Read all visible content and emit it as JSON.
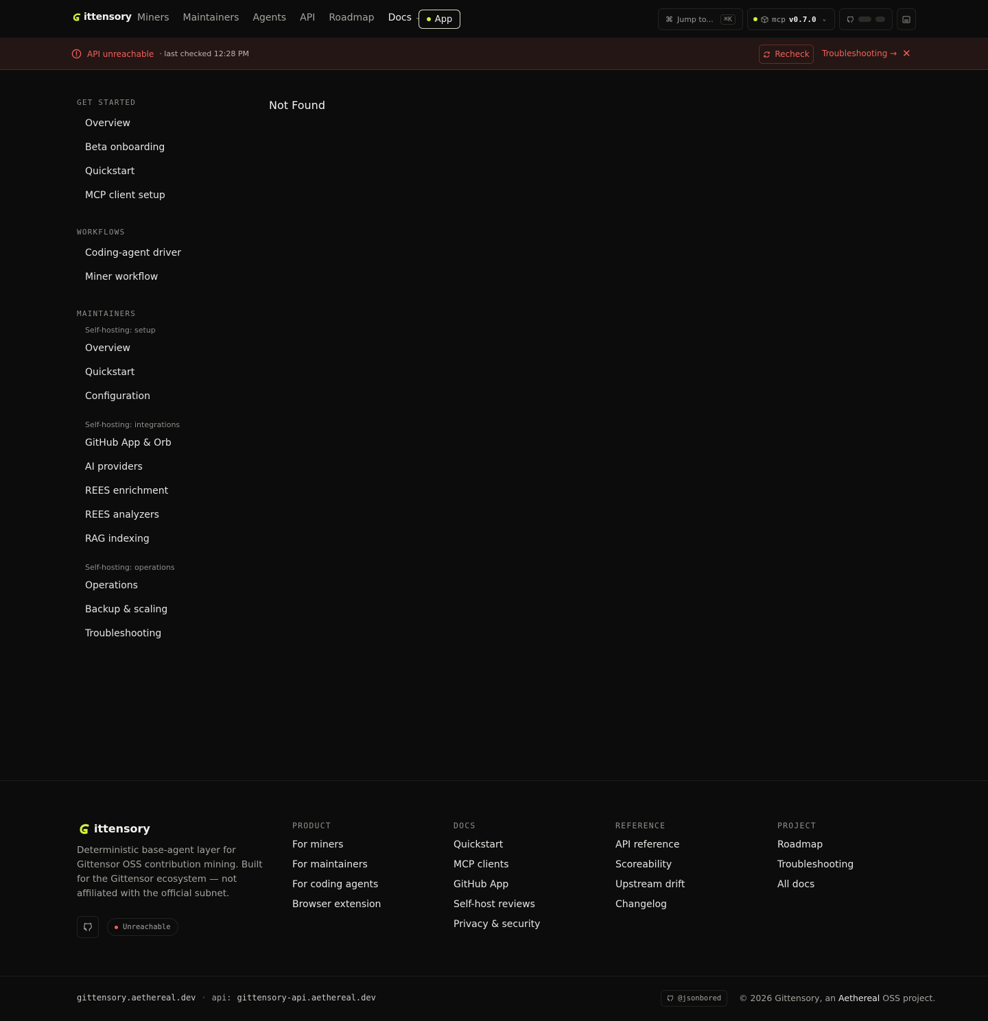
{
  "brand": {
    "name": "ittensory",
    "logo_icon": "g-leaf-logo",
    "accent": "#d4f03a"
  },
  "nav": {
    "links": [
      "Miners",
      "Maintainers",
      "Agents",
      "API",
      "Roadmap"
    ],
    "docs_label": "Docs",
    "app_label": "App",
    "jump_label": "Jump to...",
    "jump_shortcut": "⌘K",
    "mcp_label": "mcp",
    "mcp_version": "v0.7.0"
  },
  "alert": {
    "title": "API unreachable",
    "subtitle": "· last checked 12:28 PM",
    "recheck_label": "Recheck",
    "troubleshooting_label": "Troubleshooting →",
    "color": "#f2605a"
  },
  "sidebar": {
    "get_started": {
      "heading": "GET STARTED",
      "items": [
        "Overview",
        "Beta onboarding",
        "Quickstart",
        "MCP client setup"
      ]
    },
    "workflows": {
      "heading": "WORKFLOWS",
      "items": [
        "Coding-agent driver",
        "Miner workflow"
      ]
    },
    "maintainers": {
      "heading": "MAINTAINERS",
      "setup": {
        "heading": "Self-hosting: setup",
        "items": [
          "Overview",
          "Quickstart",
          "Configuration"
        ]
      },
      "integrations": {
        "heading": "Self-hosting: integrations",
        "items": [
          "GitHub App & Orb",
          "AI providers",
          "REES enrichment",
          "REES analyzers",
          "RAG indexing"
        ]
      },
      "operations": {
        "heading": "Self-hosting: operations",
        "items": [
          "Operations",
          "Backup & scaling",
          "Troubleshooting"
        ]
      }
    }
  },
  "main": {
    "title": "Not Found"
  },
  "footer": {
    "brand": "ittensory",
    "description": "Deterministic base-agent layer for Gittensor OSS contribution mining. Built for the Gittensor ecosystem — not affiliated with the official subnet.",
    "status_label": "Unreachable",
    "columns": [
      {
        "heading": "PRODUCT",
        "links": [
          "For miners",
          "For maintainers",
          "For coding agents",
          "Browser extension"
        ]
      },
      {
        "heading": "DOCS",
        "links": [
          "Quickstart",
          "MCP clients",
          "GitHub App",
          "Self-host reviews",
          "Privacy & security"
        ]
      },
      {
        "heading": "REFERENCE",
        "links": [
          "API reference",
          "Scoreability",
          "Upstream drift",
          "Changelog"
        ]
      },
      {
        "heading": "PROJECT",
        "links": [
          "Roadmap",
          "Troubleshooting",
          "All docs"
        ]
      }
    ],
    "bottom": {
      "domain": "gittensory.aethereal.dev",
      "separator": "·",
      "api_label": "api:",
      "api_domain": "gittensory-api.aethereal.dev",
      "handle": "@jsonbored",
      "copyright_pre": "© 2026 Gittensory, an",
      "copyright_org": "Aethereal",
      "copyright_post": "OSS project."
    }
  }
}
